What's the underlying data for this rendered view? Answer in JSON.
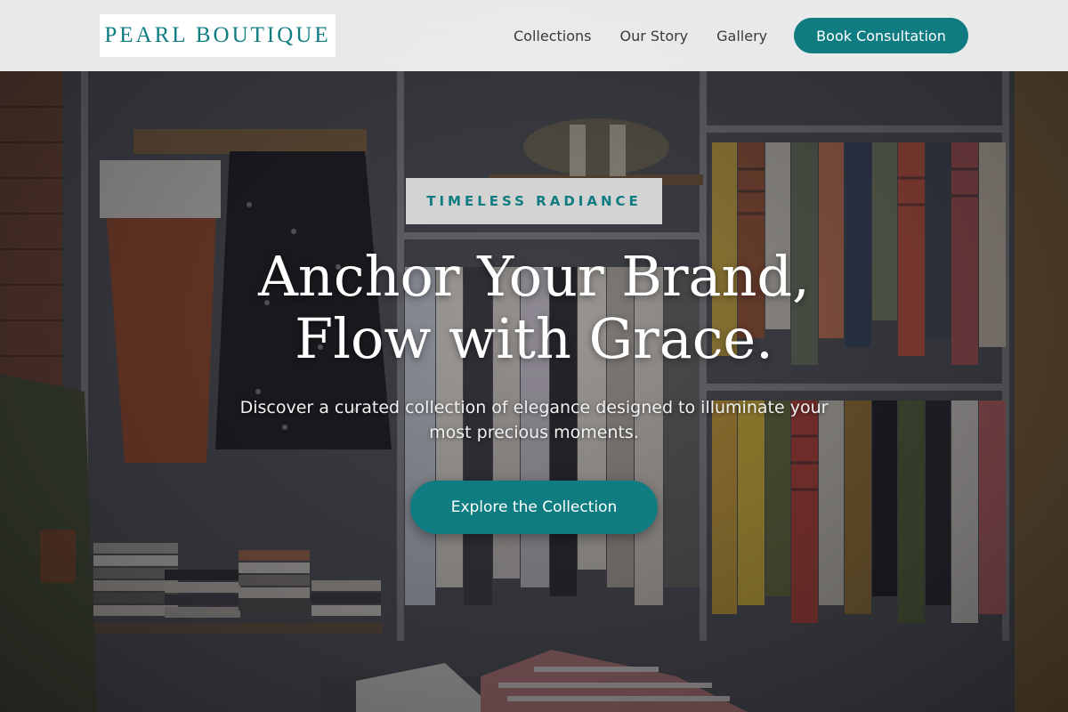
{
  "brand": {
    "name": "PEARL BOUTIQUE"
  },
  "nav": {
    "items": [
      {
        "label": "Collections"
      },
      {
        "label": "Our Story"
      },
      {
        "label": "Gallery"
      }
    ],
    "cta_label": "Book Consultation"
  },
  "hero": {
    "eyebrow": "TIMELESS RADIANCE",
    "headline_line1": "Anchor Your Brand,",
    "headline_line2": "Flow with Grace.",
    "subtitle": "Discover a curated collection of elegance designed to illuminate your most precious moments.",
    "button_label": "Explore the Collection"
  },
  "colors": {
    "accent": "#0e7c80",
    "header_bg": "#f8f8f8",
    "text_light": "#ffffff"
  }
}
